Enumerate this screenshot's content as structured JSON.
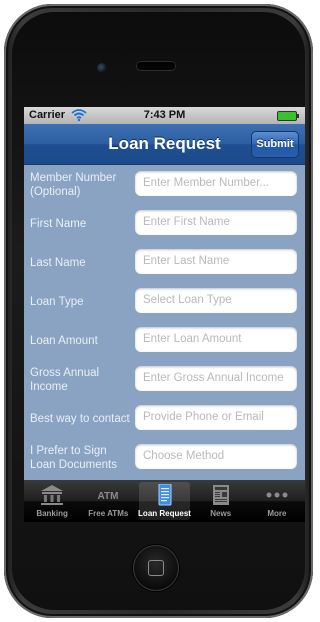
{
  "status_bar": {
    "carrier": "Carrier",
    "time": "7:43 PM"
  },
  "nav": {
    "title": "Loan Request",
    "submit_label": "Submit"
  },
  "form": {
    "fields": [
      {
        "label": "Member Number (Optional)",
        "placeholder": "Enter Member Number..."
      },
      {
        "label": "First Name",
        "placeholder": "Enter First Name"
      },
      {
        "label": "Last Name",
        "placeholder": "Enter Last Name"
      },
      {
        "label": "Loan Type",
        "placeholder": "Select Loan Type"
      },
      {
        "label": "Loan Amount",
        "placeholder": "Enter Loan Amount"
      },
      {
        "label": "Gross Annual Income",
        "placeholder": "Enter Gross Annual Income"
      },
      {
        "label": "Best way to contact",
        "placeholder": "Provide Phone or Email"
      },
      {
        "label": "I Prefer to Sign Loan Documents",
        "placeholder": "Choose Method"
      }
    ]
  },
  "tabbar": {
    "tabs": [
      {
        "label": "Banking",
        "icon": "bank-icon"
      },
      {
        "label": "Free ATMs",
        "icon": "atm-icon",
        "icon_text": "ATM"
      },
      {
        "label": "Loan Request",
        "icon": "document-icon",
        "active": true
      },
      {
        "label": "News",
        "icon": "newspaper-icon"
      },
      {
        "label": "More",
        "icon": "more-dots-icon"
      }
    ]
  },
  "colors": {
    "form_background": "#8aa3c3",
    "navbar_blue": "#2c5ea3",
    "placeholder_gray": "#b9b9b9",
    "label_text": "#e9eff7"
  }
}
